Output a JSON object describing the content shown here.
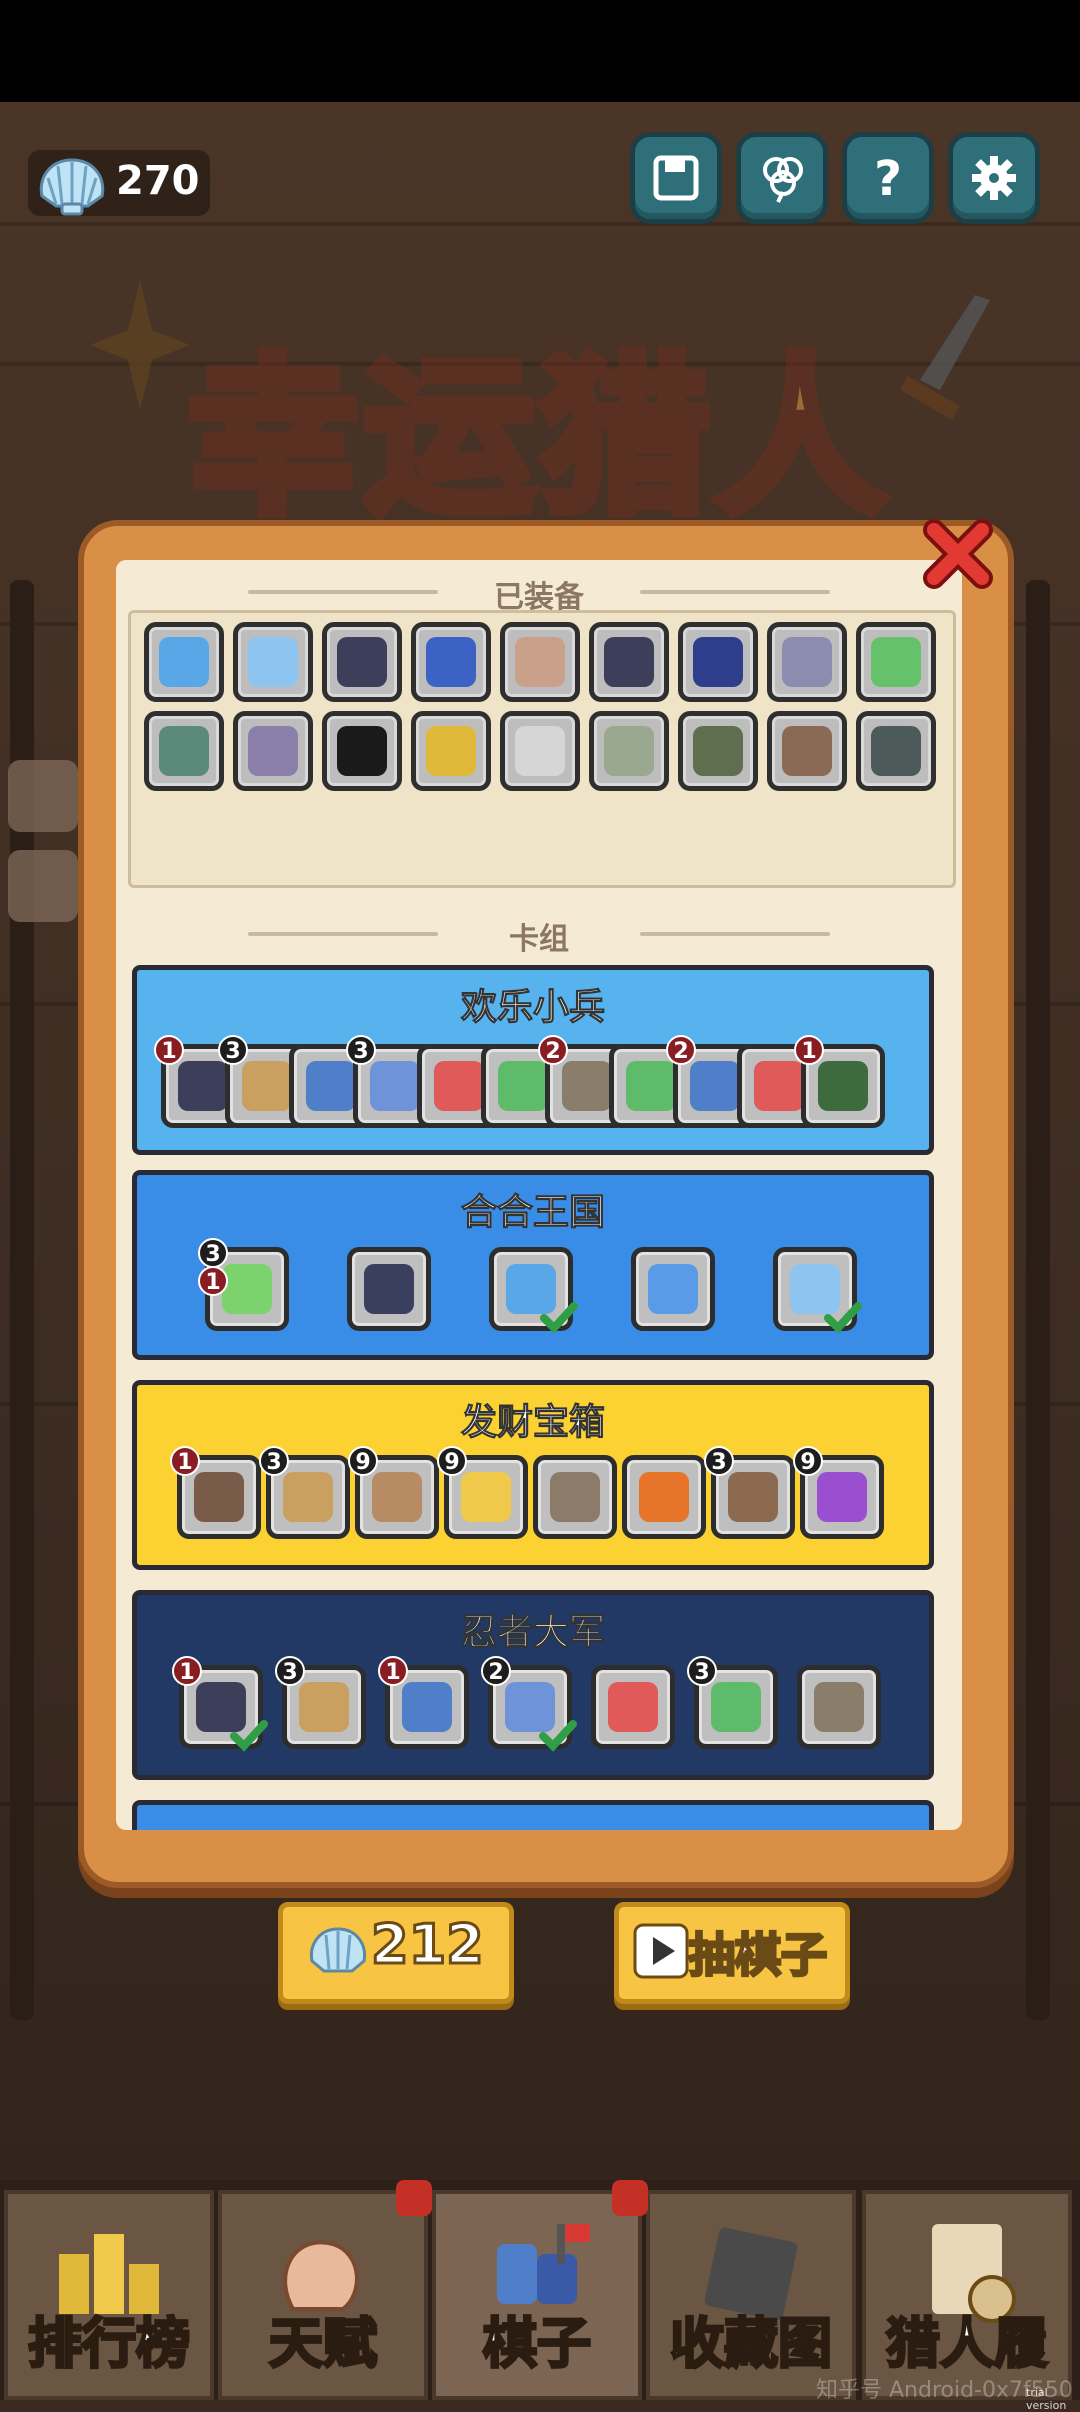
{
  "currency": {
    "shells": "270"
  },
  "top_buttons": [
    "save",
    "clover",
    "help",
    "settings"
  ],
  "title": "幸运猎人",
  "panel": {
    "equipped_title": "已装备",
    "decks_title": "卡组",
    "equipped_icons": [
      "blue-question-icon",
      "blue-crescent-icon",
      "ninja-icon",
      "blue-scroll-icon",
      "dust-cloud-icon",
      "ninja-sword-icon",
      "blue-book-icon",
      "potion-shelf-icon",
      "green-potion-icon",
      "green-witch-icon",
      "robot-box-icon",
      "black-f-icon",
      "yellow-mech-icon",
      "white-mech-icon",
      "zombie-icon",
      "goblin-icon",
      "girl-hunter-icon",
      "dark-girl-icon"
    ],
    "decks": [
      {
        "name": "欢乐小兵",
        "color": "#57b3ee",
        "cards": [
          {
            "icon": "soldier-icon",
            "badge": "1",
            "badge_red": true
          },
          {
            "icon": "tent-icon",
            "badge": "3"
          },
          {
            "icon": "blue-soldier-icon",
            "badge": ""
          },
          {
            "icon": "helmet-soldier-icon",
            "badge": "3"
          },
          {
            "icon": "red-card-icon",
            "badge": ""
          },
          {
            "icon": "green-card-icon",
            "badge": ""
          },
          {
            "icon": "crate-soldier-icon",
            "badge": "2",
            "badge_red": true
          },
          {
            "icon": "green-card-icon",
            "badge": ""
          },
          {
            "icon": "blue-soldier-icon",
            "badge": "2",
            "badge_red": true
          },
          {
            "icon": "red-card-icon",
            "badge": ""
          },
          {
            "icon": "green-ninja-icon",
            "badge": "1",
            "badge_red": true
          }
        ]
      },
      {
        "name": "合合王国",
        "color": "#3a8de6",
        "cards": [
          {
            "icon": "green-slime-icon",
            "badge": "3",
            "badge2": "1"
          },
          {
            "icon": "cowboy-icon",
            "badge": ""
          },
          {
            "icon": "blue-question-icon",
            "badge": "",
            "check": true
          },
          {
            "icon": "king-slime-icon",
            "badge": ""
          },
          {
            "icon": "blue-crescent-icon",
            "badge": "",
            "check": true
          }
        ]
      },
      {
        "name": "发财宝箱",
        "color": "#fcd232",
        "cards": [
          {
            "icon": "thief-icon",
            "badge": "1",
            "badge_red": true
          },
          {
            "icon": "tent-icon",
            "badge": "3"
          },
          {
            "icon": "brown-chest-icon",
            "badge": "9"
          },
          {
            "icon": "gold-chest-icon",
            "badge": "9"
          },
          {
            "icon": "pickaxe-icon",
            "badge": ""
          },
          {
            "icon": "key-icon",
            "badge": ""
          },
          {
            "icon": "bag-icon",
            "badge": "3"
          },
          {
            "icon": "purple-chest-icon",
            "badge": "9"
          }
        ]
      },
      {
        "name": "忍者大军",
        "color": "#223965",
        "cards": [
          {
            "icon": "ninja-icon",
            "badge": "1",
            "badge_red": true,
            "check": true
          },
          {
            "icon": "tent-icon",
            "badge": "3"
          },
          {
            "icon": "ninja-star-icon",
            "badge": "1",
            "badge_red": true
          },
          {
            "icon": "blue-scroll-icon",
            "badge": "2",
            "check": true
          },
          {
            "icon": "flag-icon",
            "badge": ""
          },
          {
            "icon": "ninja-squad-icon",
            "badge": "3"
          },
          {
            "icon": "kunai-icon",
            "badge": ""
          }
        ]
      }
    ]
  },
  "actions": {
    "cost": "212",
    "draw_label": "抽棋子"
  },
  "nav": [
    {
      "label": "排行榜",
      "icon": "trophy-icon"
    },
    {
      "label": "天赋",
      "icon": "muscle-icon"
    },
    {
      "label": "棋子",
      "icon": "chess-pieces-icon",
      "active": true
    },
    {
      "label": "收藏图",
      "icon": "book-icon"
    },
    {
      "label": "猎人履",
      "icon": "hunter-record-icon"
    }
  ],
  "watermark": "知乎号 Android-0x7f550",
  "trial": "trial version",
  "colors": {
    "panel_orange": "#d98f45",
    "panel_cream": "#f5ebd5",
    "button_yellow": "#f7c443"
  }
}
